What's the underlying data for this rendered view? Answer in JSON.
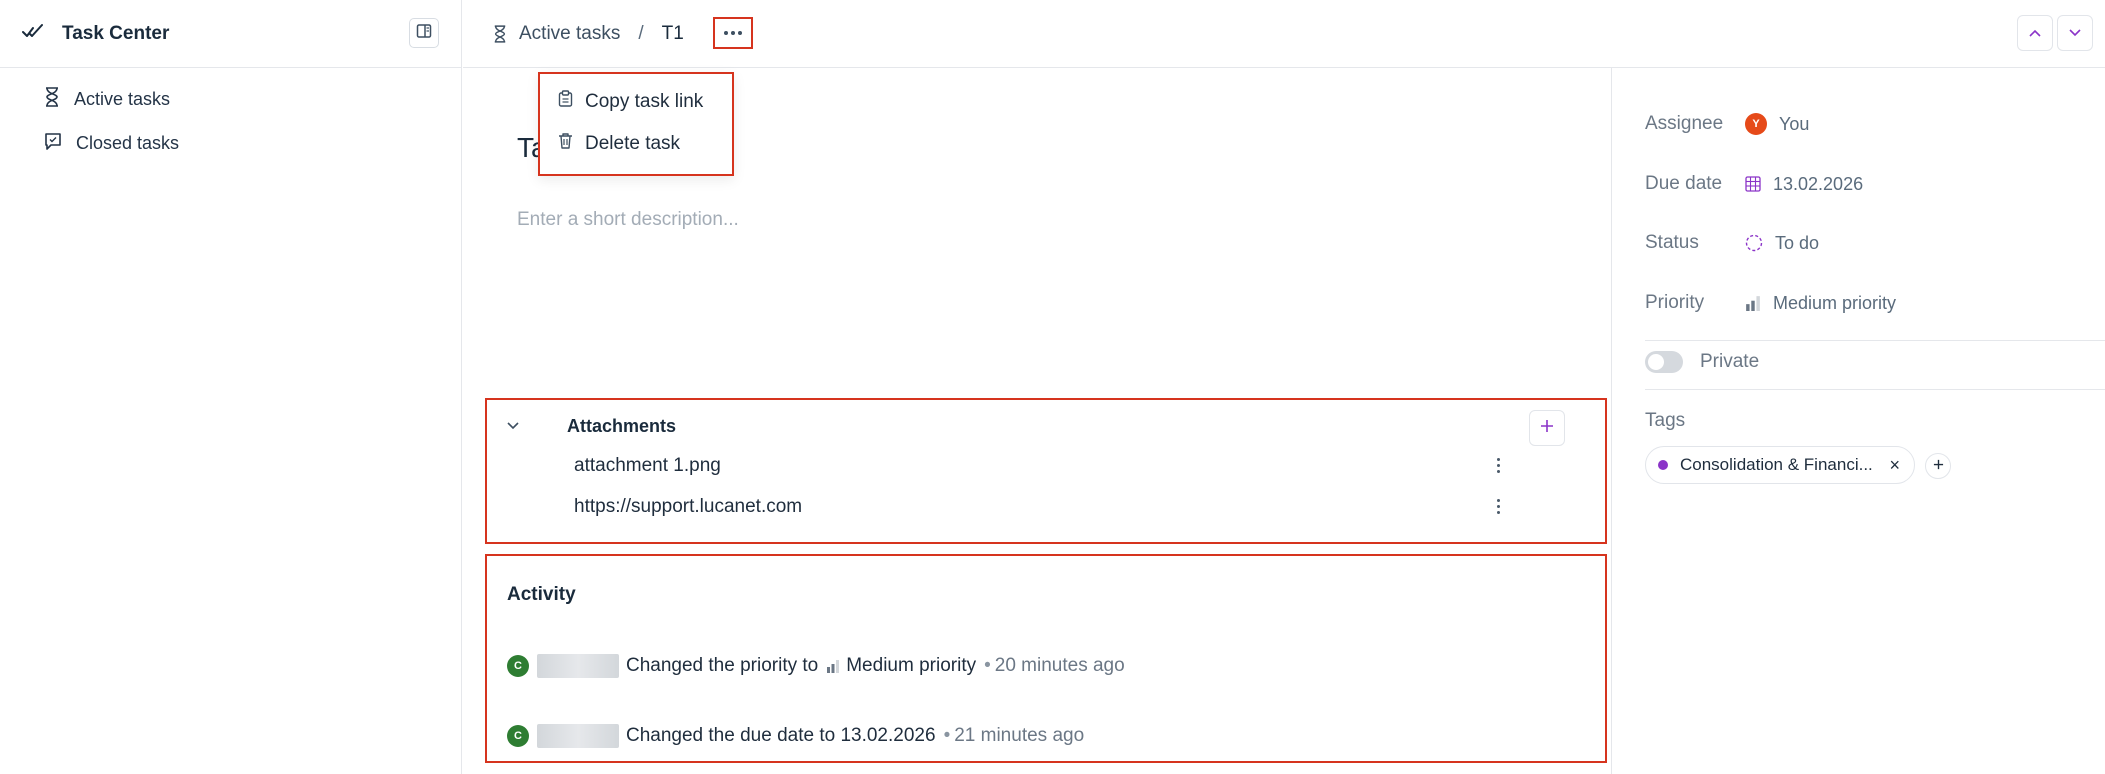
{
  "sidebar": {
    "title": "Task Center",
    "items": [
      {
        "label": "Active tasks"
      },
      {
        "label": "Closed tasks"
      }
    ]
  },
  "breadcrumb": {
    "parent": "Active tasks",
    "separator": "/",
    "current": "T1"
  },
  "menu": {
    "items": [
      {
        "label": "Copy task link"
      },
      {
        "label": "Delete task"
      }
    ]
  },
  "task": {
    "title_visible": "Ta",
    "description_placeholder": "Enter a short description..."
  },
  "attachments": {
    "header": "Attachments",
    "items": [
      {
        "name": "attachment 1.png"
      },
      {
        "name": "https://support.lucanet.com"
      }
    ]
  },
  "activity": {
    "header": "Activity",
    "entries": [
      {
        "avatar": "C",
        "text": "Changed the priority to",
        "value": "Medium priority",
        "time": "20 minutes ago"
      },
      {
        "avatar": "C",
        "text": "Changed the due date to 13.02.2026",
        "value": "",
        "time": "21 minutes ago"
      }
    ]
  },
  "details": {
    "assignee_label": "Assignee",
    "assignee_avatar": "Y",
    "assignee_value": "You",
    "due_label": "Due date",
    "due_value": "13.02.2026",
    "status_label": "Status",
    "status_value": "To do",
    "priority_label": "Priority",
    "priority_value": "Medium priority",
    "private_label": "Private",
    "tags_label": "Tags",
    "tags": [
      {
        "label": "Consolidation & Financi...",
        "color": "#8b34c8"
      }
    ]
  },
  "colors": {
    "accent": "#8b34c8",
    "highlight": "#d6341e"
  }
}
